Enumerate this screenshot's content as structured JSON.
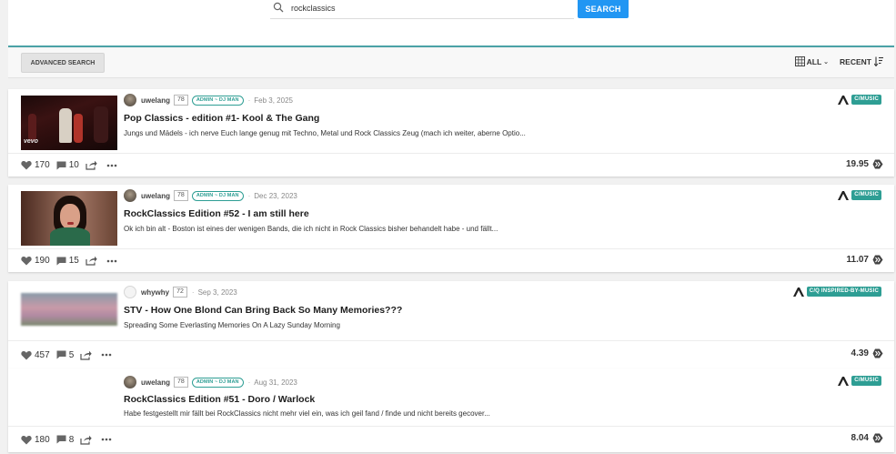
{
  "search": {
    "value": "rockclassics",
    "button_label": "SEARCH"
  },
  "filters": {
    "advanced_label": "ADVANCED SEARCH",
    "type_label": "ALL",
    "sort_label": "RECENT"
  },
  "colors": {
    "accent": "#2196f3",
    "community": "#2e9e94",
    "panel_border": "#4ba2a6"
  },
  "posts": [
    {
      "author": "uwelang",
      "reputation": "78",
      "role": "ADMIN ~ DJ MAN",
      "date": "Feb 3, 2025",
      "title": "Pop Classics - edition #1- Kool & The Gang",
      "description": "Jungs und Mädels - ich nerve Euch lange genug mit Techno, Metal und Rock Classics Zeug (mach ich weiter, aberne Optio...",
      "community": "C/MUSIC",
      "votes": "170",
      "comments": "10",
      "payout": "19.95",
      "thumb_caption": "vevo"
    },
    {
      "author": "uwelang",
      "reputation": "78",
      "role": "ADMIN ~ DJ MAN",
      "date": "Dec 23, 2023",
      "title": "RockClassics Edition #52 - I am still here",
      "description": "Ok ich bin alt - Boston ist eines der wenigen Bands, die ich nicht in Rock Classics bisher behandelt habe - und fällt...",
      "community": "C/MUSIC",
      "votes": "190",
      "comments": "15",
      "payout": "11.07"
    },
    {
      "author": "whywhy",
      "reputation": "72",
      "role": "",
      "date": "Sep 3, 2023",
      "title": "STV - How One Blond Can Bring Back So Many Memories???",
      "description": "Spreading Some Everlasting Memories On A Lazy Sunday Morning",
      "community": "C/Q INSPIRED-BY-MUSIC",
      "votes": "457",
      "comments": "5",
      "payout": "4.39"
    },
    {
      "author": "uwelang",
      "reputation": "78",
      "role": "ADMIN ~ DJ MAN",
      "date": "Aug 31, 2023",
      "title": "RockClassics Edition #51 - Doro / Warlock",
      "description": "Habe festgestellt mir fällt bei RockClassics nicht mehr viel ein, was ich geil fand / finde und nicht bereits gecover...",
      "community": "C/MUSIC",
      "votes": "180",
      "comments": "8",
      "payout": "8.04"
    }
  ]
}
